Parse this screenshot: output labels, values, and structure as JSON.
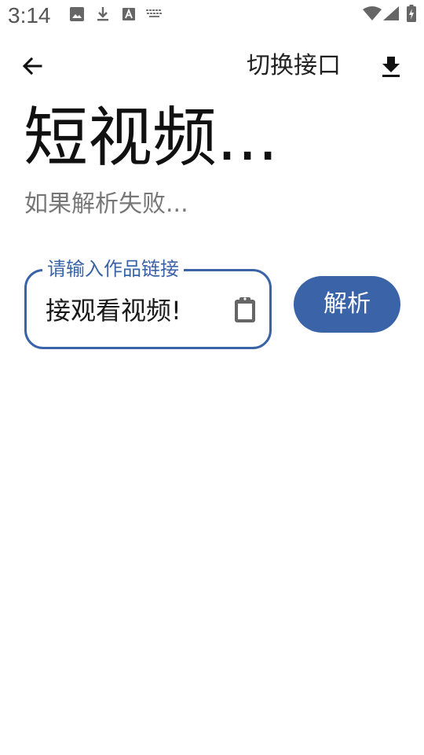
{
  "status_bar": {
    "time": "3:14",
    "left_icons": [
      "image-icon",
      "download-icon",
      "text-a-icon",
      "keyboard-icon"
    ],
    "right_icons": [
      "wifi-icon",
      "cell-signal-icon",
      "battery-charging-icon"
    ]
  },
  "toolbar": {
    "back_icon": "arrow-left-icon",
    "switch_api_label": "切换接口",
    "download_icon": "download-icon"
  },
  "header": {
    "title": "短视频...",
    "subtitle": "如果解析失败..."
  },
  "link_input": {
    "label": "请输入作品链接",
    "value": "接观看视频!",
    "paste_icon": "clipboard-icon"
  },
  "parse_button": {
    "label": "解析"
  },
  "colors": {
    "accent": "#3a63a8",
    "subtitle_gray": "#777777",
    "background": "#ffffff"
  }
}
